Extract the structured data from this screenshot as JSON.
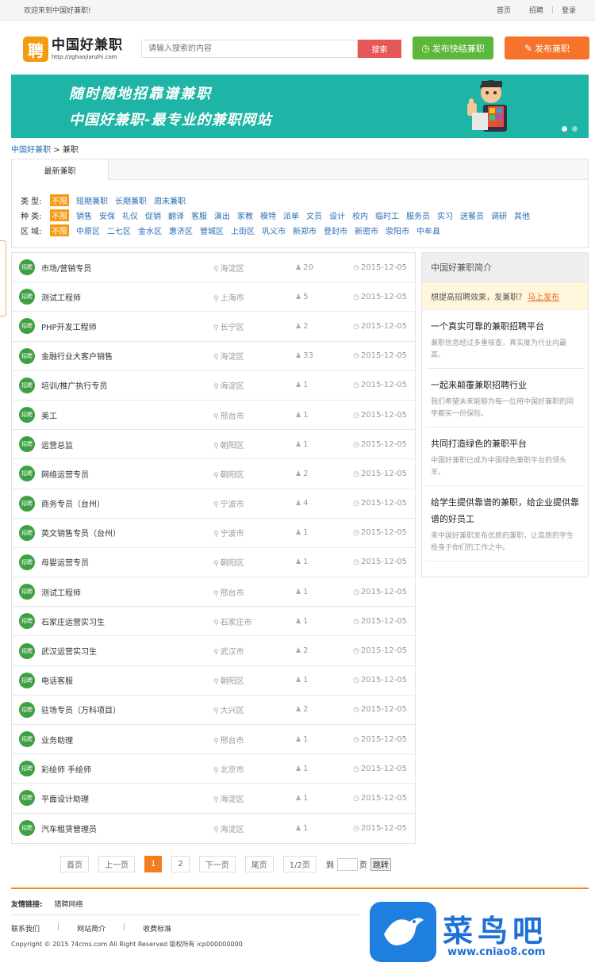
{
  "topbar": {
    "welcome": "欢迎来到中国好兼职!",
    "links": [
      "首页",
      "招聘",
      "登录"
    ]
  },
  "header": {
    "logo_mark": "聘",
    "logo_text": "中国好兼职",
    "logo_url": "http://zghaojianzhi.com",
    "search_placeholder": "请输入搜索的内容",
    "search_button": "搜索",
    "quick_button": "发布快结兼职",
    "post_button": "发布兼职"
  },
  "banner": {
    "line1": "随时随地招靠谱兼职",
    "line2": "中国好兼职-最专业的兼职网站"
  },
  "breadcrumb": {
    "home": "中国好兼职",
    "sep": ">",
    "current": "兼职"
  },
  "filter": {
    "tab": "最新兼职",
    "rows": [
      {
        "label": "类 型:",
        "options": [
          "不限",
          "短期兼职",
          "长期兼职",
          "周末兼职"
        ]
      },
      {
        "label": "种 类:",
        "options": [
          "不限",
          "销售",
          "安保",
          "礼仪",
          "促销",
          "翻译",
          "客服",
          "演出",
          "家教",
          "模特",
          "派单",
          "文员",
          "设计",
          "校内",
          "临时工",
          "服务员",
          "实习",
          "送餐员",
          "调研",
          "其他"
        ]
      },
      {
        "label": "区 域:",
        "options": [
          "不限",
          "中原区",
          "二七区",
          "金水区",
          "惠济区",
          "管城区",
          "上街区",
          "巩义市",
          "新郑市",
          "登封市",
          "新密市",
          "荥阳市",
          "中牟县"
        ]
      }
    ]
  },
  "jobs": [
    {
      "title": "市场/营销专员",
      "location": "海淀区",
      "count": "20",
      "date": "2015-12-05"
    },
    {
      "title": "测试工程师",
      "location": "上海市",
      "count": "5",
      "date": "2015-12-05"
    },
    {
      "title": "PHP开发工程师",
      "location": "长宁区",
      "count": "2",
      "date": "2015-12-05"
    },
    {
      "title": "金融行业大客户销售",
      "location": "海淀区",
      "count": "33",
      "date": "2015-12-05"
    },
    {
      "title": "培训/推广执行专员",
      "location": "海淀区",
      "count": "1",
      "date": "2015-12-05"
    },
    {
      "title": "美工",
      "location": "邢台市",
      "count": "1",
      "date": "2015-12-05"
    },
    {
      "title": "运营总监",
      "location": "朝阳区",
      "count": "1",
      "date": "2015-12-05"
    },
    {
      "title": "网络运营专员",
      "location": "朝阳区",
      "count": "2",
      "date": "2015-12-05"
    },
    {
      "title": "商务专员（台州）",
      "location": "宁波市",
      "count": "4",
      "date": "2015-12-05"
    },
    {
      "title": "英文销售专员（台州）",
      "location": "宁波市",
      "count": "1",
      "date": "2015-12-05"
    },
    {
      "title": "母婴运营专员",
      "location": "朝阳区",
      "count": "1",
      "date": "2015-12-05"
    },
    {
      "title": "测试工程师",
      "location": "邢台市",
      "count": "1",
      "date": "2015-12-05"
    },
    {
      "title": "石家庄运营实习生",
      "location": "石家庄市",
      "count": "1",
      "date": "2015-12-05"
    },
    {
      "title": "武汉运营实习生",
      "location": "武汉市",
      "count": "2",
      "date": "2015-12-05"
    },
    {
      "title": "电话客服",
      "location": "朝阳区",
      "count": "1",
      "date": "2015-12-05"
    },
    {
      "title": "驻场专员（万科项目）",
      "location": "大兴区",
      "count": "2",
      "date": "2015-12-05"
    },
    {
      "title": "业务助理",
      "location": "邢台市",
      "count": "1",
      "date": "2015-12-05"
    },
    {
      "title": "彩绘师 手绘师",
      "location": "北京市",
      "count": "1",
      "date": "2015-12-05"
    },
    {
      "title": "平面设计助理",
      "location": "海淀区",
      "count": "1",
      "date": "2015-12-05"
    },
    {
      "title": "汽车租赁管理员",
      "location": "海淀区",
      "count": "1",
      "date": "2015-12-05"
    }
  ],
  "job_badge": "招聘",
  "sidebar": {
    "title": "中国好兼职简介",
    "promo_text": "想提高招聘效果，发兼职？",
    "promo_link": "马上发布",
    "items": [
      {
        "title": "一个真实可靠的兼职招聘平台",
        "desc": "兼职信息经过多重核查，真实度为行业内最高。"
      },
      {
        "title": "一起来颠覆兼职招聘行业",
        "desc": "我们希望未来能够为每一位用中国好兼职的同学都买一份保险。"
      },
      {
        "title": "共同打造绿色的兼职平台",
        "desc": "中国好兼职已成为中国绿色兼职平台的领头羊。"
      },
      {
        "title": "给学生提供靠谱的兼职，给企业提供靠谱的好员工",
        "desc": "来中国好兼职发布优质的兼职，让高质的学生投身于你们的工作之中。"
      }
    ]
  },
  "pager": {
    "first": "首页",
    "prev": "上一页",
    "pages": [
      "1",
      "2"
    ],
    "next": "下一页",
    "last": "尾页",
    "info": "1/2页",
    "to": "到",
    "page_unit": "页",
    "go": "跳转"
  },
  "footer": {
    "friends_label": "友情链接:",
    "friends": [
      "猎聘网络"
    ],
    "links": [
      "联系我们",
      "网站简介",
      "收费标准"
    ],
    "copyright": "Copyright © 2015 74cms.com All Right Reserved 版权所有 icp000000000"
  },
  "watermark": {
    "text": "菜鸟吧",
    "url": "www.cniao8.com"
  },
  "colors": {
    "orange": "#f47c1c",
    "green": "#5cb73a",
    "teal": "#1eb5a6",
    "link": "#2a6db3",
    "red": "#e85757"
  }
}
